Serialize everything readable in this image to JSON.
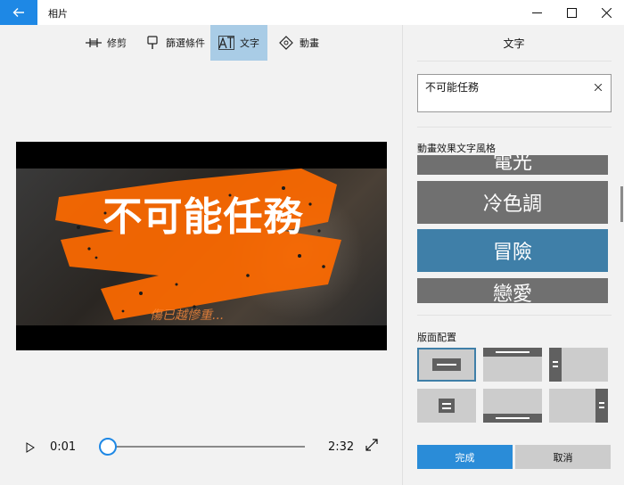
{
  "window": {
    "title": "相片"
  },
  "toolbar": {
    "trim_label": "修剪",
    "filters_label": "篩選條件",
    "text_label": "文字",
    "motion_label": "動畫",
    "active_tool": "text"
  },
  "video": {
    "overlay_title": "不可能任務",
    "overlay_subtitle": "傷已越慘重..."
  },
  "playback": {
    "current_time": "0:01",
    "total_time": "2:32",
    "progress": 0.04
  },
  "panel": {
    "title": "文字",
    "text_value": "不可能任務",
    "styles_label": "動畫效果文字風格",
    "styles": [
      {
        "label": "電光",
        "selected": false
      },
      {
        "label": "冷色調",
        "selected": false
      },
      {
        "label": "冒險",
        "selected": true
      },
      {
        "label": "戀愛",
        "selected": false
      }
    ],
    "layout_label": "版面配置",
    "layouts_selected_index": 0,
    "done_label": "完成",
    "cancel_label": "取消"
  },
  "colors": {
    "accent": "#1e88e5",
    "selected_style": "#3f7fa8",
    "active_tool": "#a9cce6",
    "splash": "#ff6a00"
  }
}
